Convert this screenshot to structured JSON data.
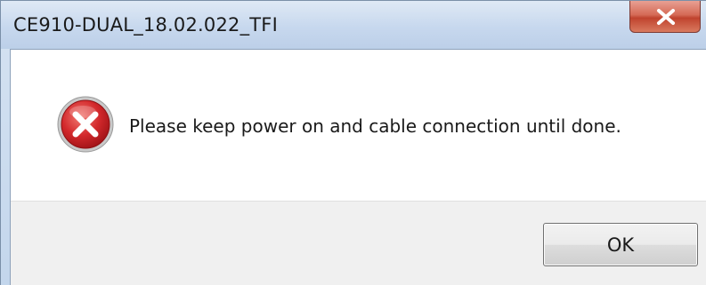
{
  "window": {
    "title": "CE910-DUAL_18.02.022_TFI",
    "close_icon": "close-icon"
  },
  "dialog": {
    "icon": "error-icon",
    "message": "Please keep power on and cable connection until done.",
    "ok_label": "OK"
  },
  "colors": {
    "error_red": "#c8252b",
    "close_red": "#c0432e",
    "titlebar": "#c7d8ee",
    "footer": "#f0f0f0"
  }
}
